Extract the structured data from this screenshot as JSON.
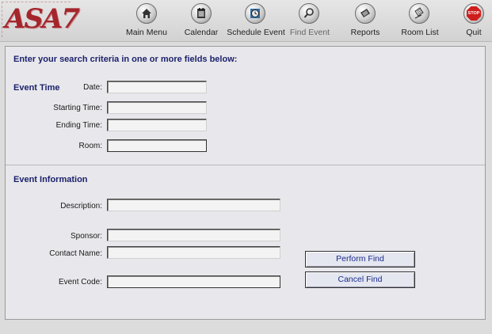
{
  "app": {
    "logo_text": "ASA7"
  },
  "nav": [
    {
      "label": "Main Menu",
      "icon": "home-icon"
    },
    {
      "label": "Calendar",
      "icon": "calendar-icon"
    },
    {
      "label": "Schedule Event",
      "icon": "clock-icon"
    },
    {
      "label": "Find Event",
      "icon": "magnifier-icon",
      "state": "disabled"
    },
    {
      "label": "Reports",
      "icon": "money-icon"
    },
    {
      "label": "Room List",
      "icon": "list-icon"
    },
    {
      "label": "Quit",
      "icon": "stop-sign-icon",
      "badge": "STOP"
    }
  ],
  "form": {
    "instructions": "Enter your search criteria in one or more fields below:",
    "event_time": {
      "heading": "Event Time",
      "date_label": "Date:",
      "date_value": "",
      "start_label": "Starting Time:",
      "start_value": "",
      "end_label": "Ending Time:",
      "end_value": "",
      "room_label": "Room:",
      "room_value": ""
    },
    "event_info": {
      "heading": "Event Information",
      "description_label": "Description:",
      "description_value": "",
      "sponsor_label": "Sponsor:",
      "sponsor_value": "",
      "contact_label": "Contact Name:",
      "contact_value": "",
      "code_label": "Event Code:",
      "code_value": ""
    },
    "perform_find_label": "Perform Find",
    "cancel_find_label": "Cancel Find"
  },
  "colors": {
    "heading": "#1a1f6b",
    "button_text": "#1a2b8c",
    "logo": "#a4262c",
    "stop": "#cf1c1c"
  }
}
